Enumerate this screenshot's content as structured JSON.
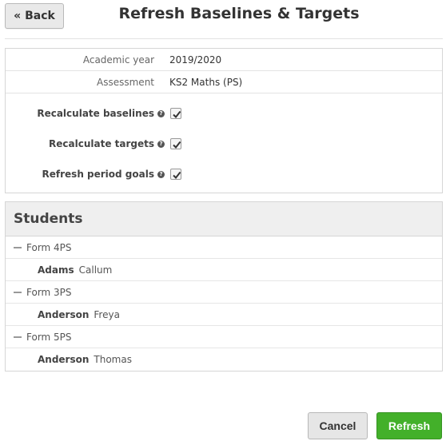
{
  "header": {
    "back_label": "« Back",
    "title": "Refresh Baselines & Targets"
  },
  "settings": {
    "academic_year": {
      "label": "Academic year",
      "value": "2019/2020"
    },
    "assessment": {
      "label": "Assessment",
      "value": "KS2 Maths (PS)"
    },
    "options": [
      {
        "label": "Recalculate baselines",
        "checked": true,
        "help_icon": "question-circle-icon"
      },
      {
        "label": "Recalculate targets",
        "checked": true,
        "help_icon": "question-circle-icon"
      },
      {
        "label": "Refresh period goals",
        "checked": true,
        "help_icon": "question-circle-icon"
      }
    ],
    "help_glyph": "?"
  },
  "students": {
    "heading": "Students",
    "groups": [
      {
        "form": "Form 4PS",
        "students": [
          {
            "surname": "Adams",
            "forename": "Callum"
          }
        ]
      },
      {
        "form": "Form 3PS",
        "students": [
          {
            "surname": "Anderson",
            "forename": "Freya"
          }
        ]
      },
      {
        "form": "Form 5PS",
        "students": [
          {
            "surname": "Anderson",
            "forename": "Thomas"
          }
        ]
      }
    ]
  },
  "footer": {
    "cancel_label": "Cancel",
    "refresh_label": "Refresh"
  },
  "colors": {
    "refresh_button": "#43b02a",
    "cancel_button": "#e6e6e6",
    "section_header_bg": "#efefef"
  }
}
